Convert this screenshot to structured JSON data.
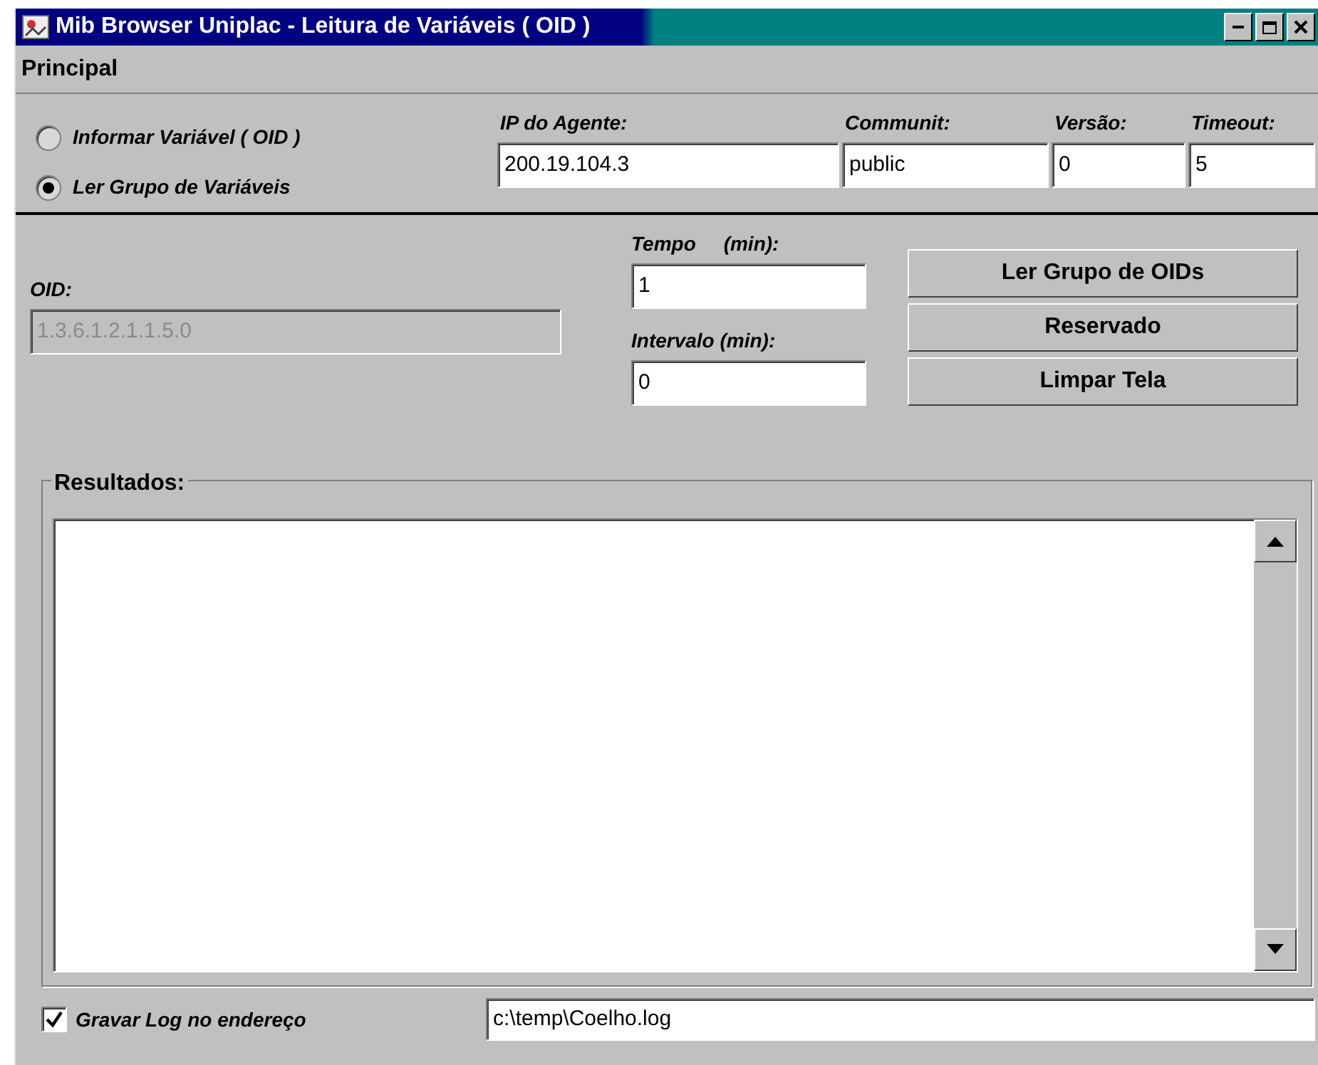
{
  "window": {
    "title": "Mib Browser Uniplac - Leitura de Variáveis ( OID )"
  },
  "menu": [
    {
      "label": "Principal"
    }
  ],
  "mode_options": [
    {
      "label": "Informar Variável ( OID )",
      "selected": false
    },
    {
      "label": "Ler Grupo de Variáveis",
      "selected": true
    }
  ],
  "agent_fields": [
    {
      "label": "IP do Agente:",
      "value": "200.19.104.3"
    },
    {
      "label": "Communit:",
      "value": "public"
    },
    {
      "label": "Versão:",
      "value": "0"
    },
    {
      "label": "Timeout:",
      "value": "5"
    }
  ],
  "oid": {
    "label": "OID:",
    "value": "1.3.6.1.2.1.1.5.0",
    "disabled": true
  },
  "timing_fields": [
    {
      "label": "Tempo     (min):",
      "value": "1"
    },
    {
      "label": "Intervalo (min):",
      "value": "0"
    }
  ],
  "buttons": [
    {
      "label": "Ler Grupo de OIDs"
    },
    {
      "label": "Reservado"
    },
    {
      "label": "Limpar Tela"
    }
  ],
  "results": {
    "title": "Resultados:"
  },
  "log": {
    "label": "Gravar Log no endereço",
    "checked": true,
    "value": "c:\\temp\\Coelho.log"
  }
}
